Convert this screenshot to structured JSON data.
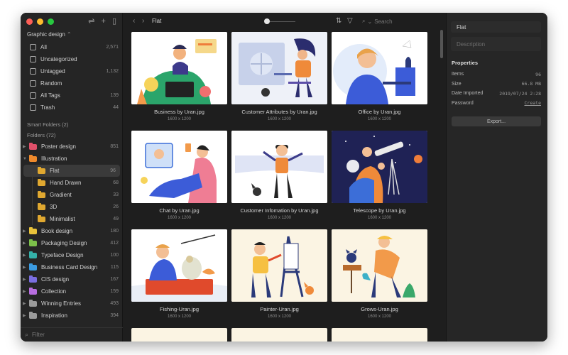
{
  "sidebar": {
    "library_name": "Graphic design",
    "library_chevron": "⌃",
    "tools": [
      "⇌",
      "+",
      "▯"
    ],
    "items": [
      {
        "label": "All",
        "count": "2,571",
        "icon": "▣"
      },
      {
        "label": "Uncategorized",
        "count": "",
        "icon": "▢"
      },
      {
        "label": "Untagged",
        "count": "1,132",
        "icon": "▤"
      },
      {
        "label": "Random",
        "count": "",
        "icon": "⊡"
      },
      {
        "label": "All Tags",
        "count": "139",
        "icon": "⊟"
      },
      {
        "label": "Trash",
        "count": "44",
        "icon": "🗑"
      }
    ],
    "smart_folders_label": "Smart Folders (2)",
    "folders_label": "Folders (72)",
    "folders": [
      {
        "label": "Poster design",
        "count": "851",
        "color": "#e0506a",
        "arrow": "▶"
      },
      {
        "label": "Illustration",
        "count": "",
        "color": "#ef8a2c",
        "arrow": "▼"
      },
      {
        "label": "Flat",
        "count": "96",
        "color": "#e0a830",
        "sub": true,
        "active": true
      },
      {
        "label": "Hand Drawn",
        "count": "68",
        "color": "#e0a830",
        "sub": true
      },
      {
        "label": "Gradient",
        "count": "33",
        "color": "#e0a830",
        "sub": true
      },
      {
        "label": "3D",
        "count": "26",
        "color": "#e0a830",
        "sub": true
      },
      {
        "label": "Minimalist",
        "count": "49",
        "color": "#e0a830",
        "sub": true
      },
      {
        "label": "Book design",
        "count": "180",
        "color": "#e8c23a",
        "arrow": "▶"
      },
      {
        "label": "Packaging Design",
        "count": "412",
        "color": "#7cc04a",
        "arrow": "▶"
      },
      {
        "label": "Typeface Design",
        "count": "100",
        "color": "#34b0a8",
        "arrow": "▶"
      },
      {
        "label": "Business Card Design",
        "count": "115",
        "color": "#3b9be0",
        "arrow": "▶"
      },
      {
        "label": "CIS design",
        "count": "167",
        "color": "#7a6ee0",
        "arrow": "▶"
      },
      {
        "label": "Collection",
        "count": "159",
        "color": "#b86ee0",
        "arrow": "▶"
      },
      {
        "label": "Winning Entries",
        "count": "493",
        "color": "#9a9a9a",
        "arrow": "▶"
      },
      {
        "label": "Inspiration",
        "count": "394",
        "color": "#9a9a9a",
        "arrow": "▶"
      }
    ],
    "filter_placeholder": "Filter"
  },
  "toolbar": {
    "back": "‹",
    "forward": "›",
    "folder_name": "Flat",
    "sort_icon": "⇅",
    "filter_icon": "▽",
    "search_placeholder": "Search",
    "search_chevron": "⌄"
  },
  "grid": {
    "items": [
      {
        "name": "Business by Uran.jpg",
        "dim": "1600 x 1200"
      },
      {
        "name": "Customer Attributes by Uran.jpg",
        "dim": "1600 x 1200"
      },
      {
        "name": "Office by Uran.jpg",
        "dim": "1600 x 1200"
      },
      {
        "name": "Chat by Uran.jpg",
        "dim": "1600 x 1200"
      },
      {
        "name": "Customer Infomation by Uran.jpg",
        "dim": "1600 x 1200"
      },
      {
        "name": "Telescope by Uran.jpg",
        "dim": "1600 x 1200"
      },
      {
        "name": "Fishing-Uran.jpg",
        "dim": "1600 x 1200"
      },
      {
        "name": "Painter-Uran.jpg",
        "dim": "1600 x 1200"
      },
      {
        "name": "Grows-Uran.jpg",
        "dim": "1600 x 1200"
      }
    ]
  },
  "inspector": {
    "title": "Flat",
    "description_placeholder": "Description",
    "properties_label": "Properties",
    "props": [
      {
        "key": "Items",
        "value": "96"
      },
      {
        "key": "Size",
        "value": "66.8 MB"
      },
      {
        "key": "Date Imported",
        "value": "2019/07/24 2:28"
      },
      {
        "key": "Password",
        "value": "Create"
      }
    ],
    "export_label": "Export..."
  }
}
